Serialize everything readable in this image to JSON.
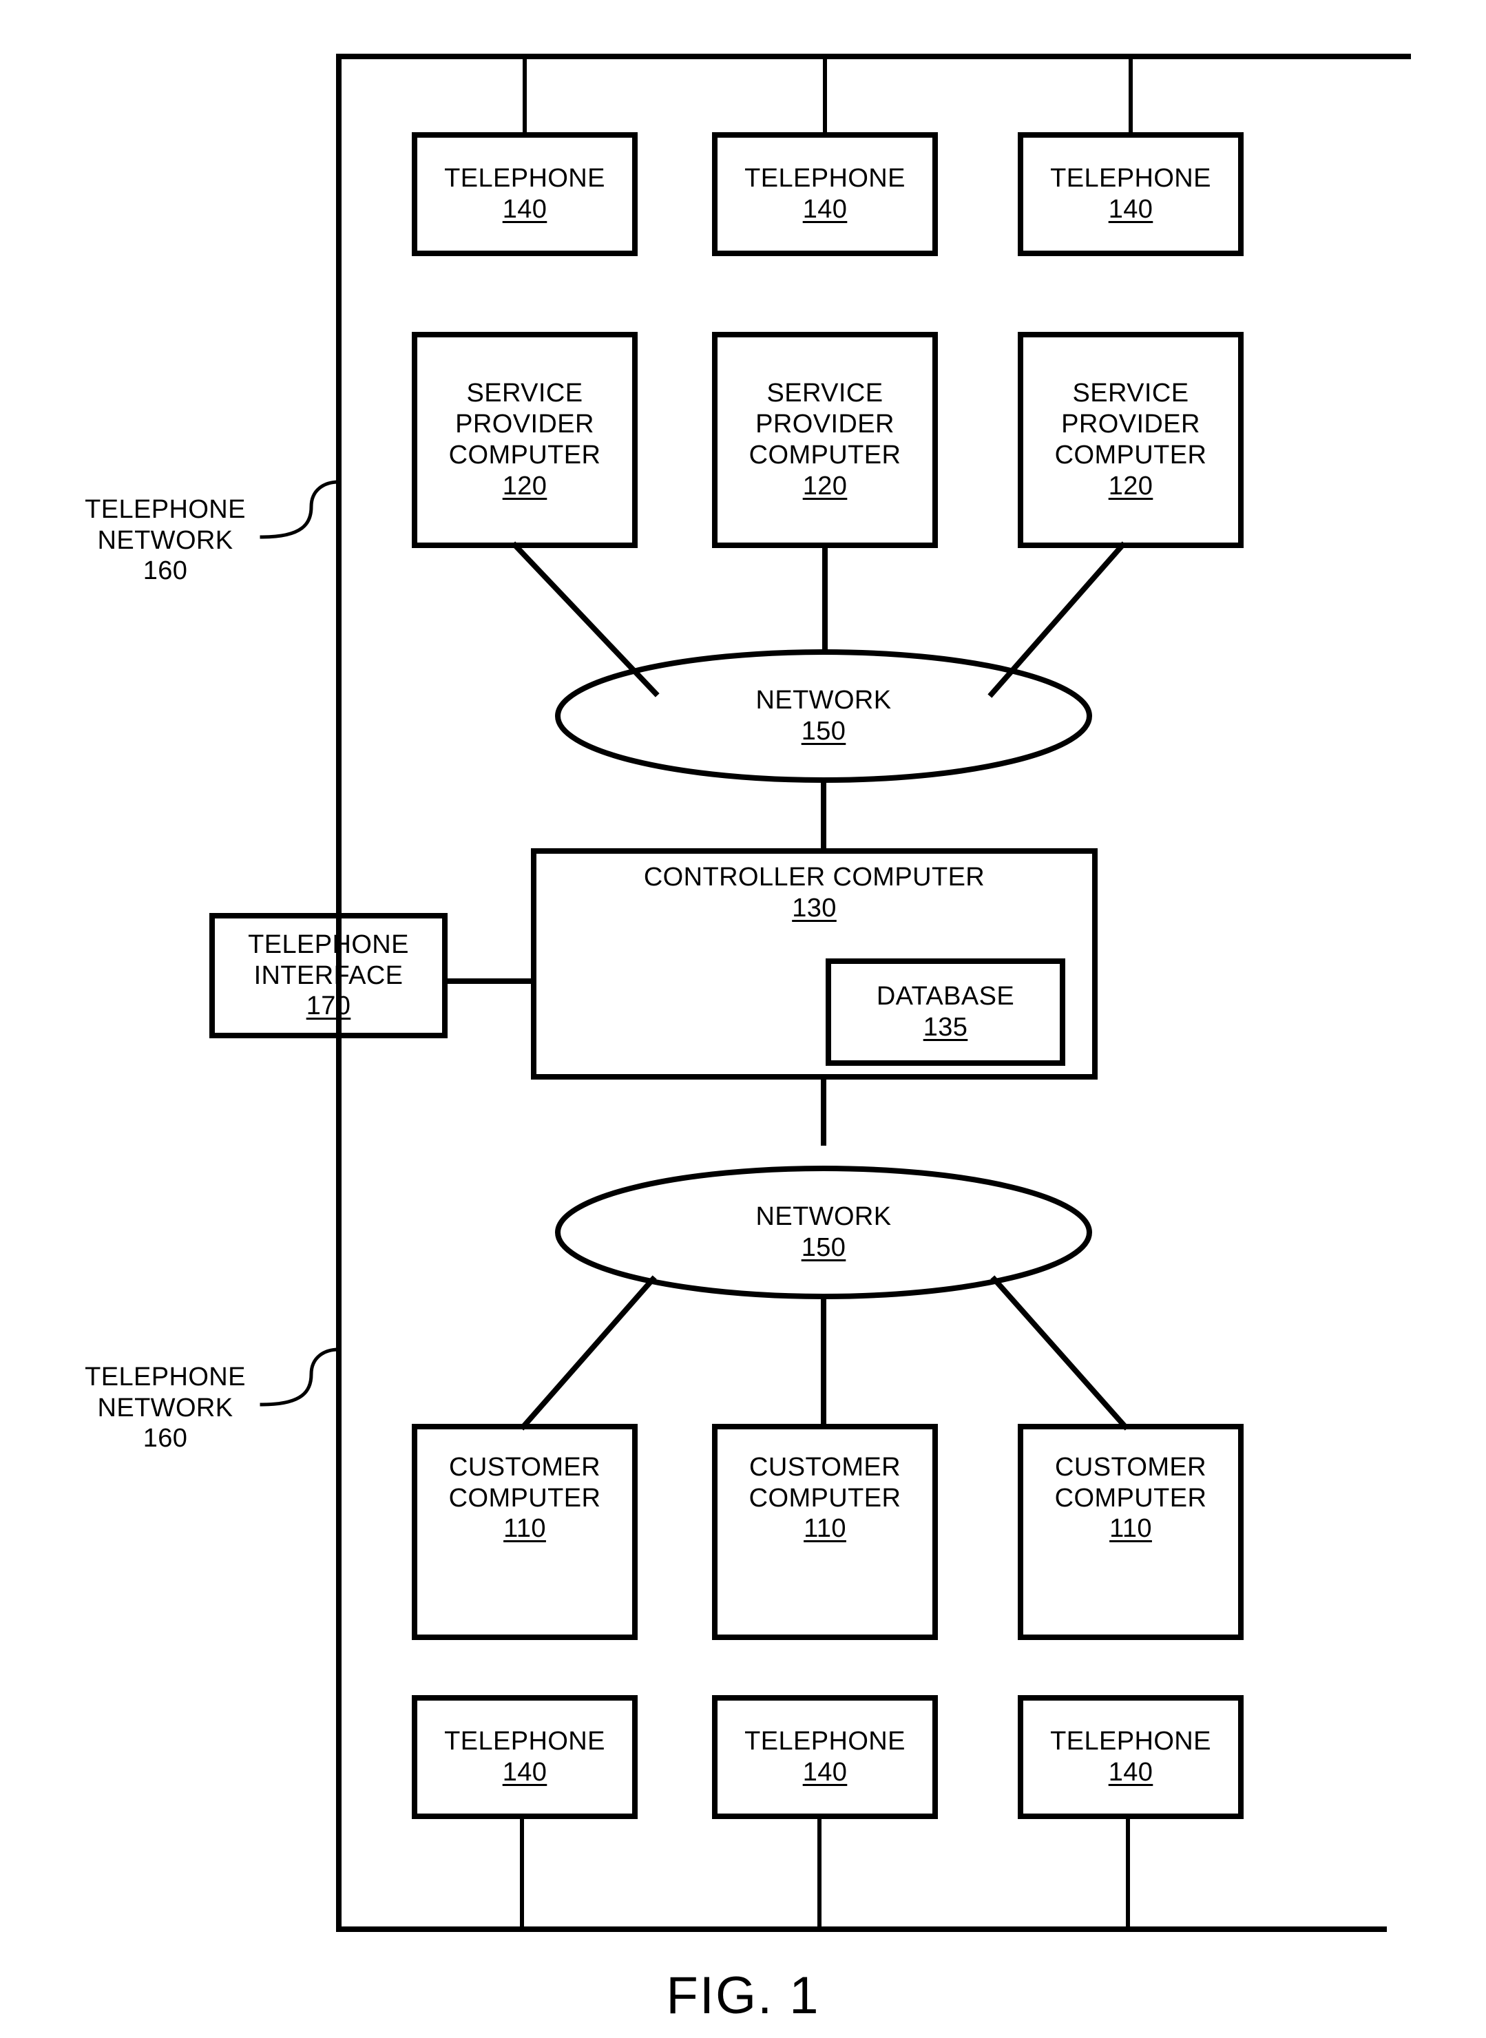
{
  "figure": {
    "caption": "FIG. 1",
    "title": "Telephone Network System Block Diagram"
  },
  "side_labels": [
    {
      "line1": "TELEPHONE",
      "line2": "NETWORK",
      "ref": "160"
    },
    {
      "line1": "TELEPHONE",
      "line2": "NETWORK",
      "ref": "160"
    }
  ],
  "telephones_top": [
    {
      "label": "TELEPHONE",
      "ref": "140"
    },
    {
      "label": "TELEPHONE",
      "ref": "140"
    },
    {
      "label": "TELEPHONE",
      "ref": "140"
    }
  ],
  "service_providers": [
    {
      "line1": "SERVICE",
      "line2": "PROVIDER",
      "line3": "COMPUTER",
      "ref": "120"
    },
    {
      "line1": "SERVICE",
      "line2": "PROVIDER",
      "line3": "COMPUTER",
      "ref": "120"
    },
    {
      "line1": "SERVICE",
      "line2": "PROVIDER",
      "line3": "COMPUTER",
      "ref": "120"
    }
  ],
  "network_top": {
    "label": "NETWORK",
    "ref": "150"
  },
  "network_bottom": {
    "label": "NETWORK",
    "ref": "150"
  },
  "controller": {
    "label": "CONTROLLER COMPUTER",
    "ref": "130"
  },
  "database": {
    "label": "DATABASE",
    "ref": "135"
  },
  "telephone_interface": {
    "line1": "TELEPHONE",
    "line2": "INTERFACE",
    "ref": "170"
  },
  "customer_computers": [
    {
      "line1": "CUSTOMER",
      "line2": "COMPUTER",
      "ref": "110"
    },
    {
      "line1": "CUSTOMER",
      "line2": "COMPUTER",
      "ref": "110"
    },
    {
      "line1": "CUSTOMER",
      "line2": "COMPUTER",
      "ref": "110"
    }
  ],
  "telephones_bottom": [
    {
      "label": "TELEPHONE",
      "ref": "140"
    },
    {
      "label": "TELEPHONE",
      "ref": "140"
    },
    {
      "label": "TELEPHONE",
      "ref": "140"
    }
  ],
  "colors": {
    "ink": "#000000",
    "paper": "#ffffff"
  }
}
